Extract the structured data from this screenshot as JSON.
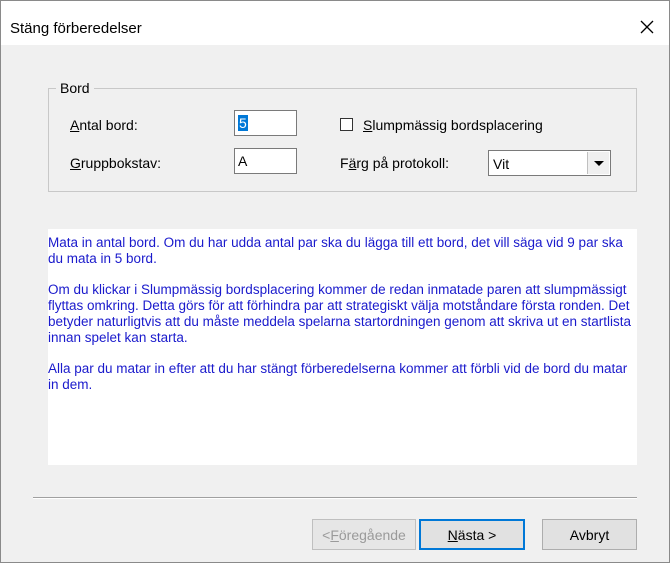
{
  "window": {
    "title": "Stäng förberedelser",
    "close_icon": "close-icon"
  },
  "group": {
    "legend": "Bord",
    "antal_bord": {
      "label_accel": "A",
      "label_rest": "ntal bord:",
      "value": "5"
    },
    "gruppbokstav": {
      "label_accel": "G",
      "label_rest": "ruppbokstav:",
      "value": "A"
    },
    "slump": {
      "label_accel": "S",
      "label_rest": "lumpmässig bordsplacering",
      "checked": false
    },
    "farg": {
      "label_pre": "F",
      "label_accel": "ä",
      "label_rest": "rg på protokoll:",
      "value": "Vit"
    }
  },
  "info": {
    "paragraphs": [
      "Mata in antal bord. Om du har udda antal par ska du lägga till ett bord, det vill säga vid 9 par ska du mata in 5 bord.",
      "Om du klickar i Slumpmässig bordsplacering kommer de redan inmatade paren att slumpmässigt flyttas omkring. Detta görs för att förhindra par att strategiskt välja motståndare första ronden. Det betyder naturligtvis att du måste meddela spelarna startordningen genom att skriva ut en startlista innan spelet kan starta.",
      "Alla par du matar in efter att du har stängt förberedelserna kommer att förbli vid de bord du matar in dem."
    ],
    "color": "#1a1acc"
  },
  "buttons": {
    "prev": {
      "pre": "< ",
      "accel": "F",
      "rest": "öregående"
    },
    "next": {
      "accel": "N",
      "rest": "ästa >"
    },
    "cancel": "Avbryt"
  }
}
